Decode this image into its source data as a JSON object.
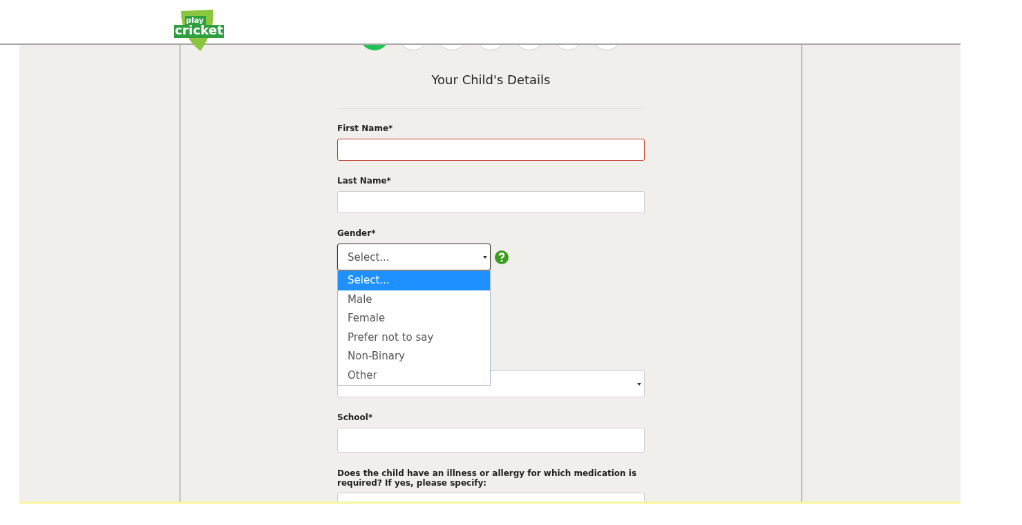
{
  "logo": {
    "top": "play",
    "bottom": "cricket"
  },
  "steps": [
    {
      "selected": true
    },
    {
      "selected": false
    },
    {
      "selected": false
    },
    {
      "selected": false
    },
    {
      "selected": false
    },
    {
      "selected": false
    },
    {
      "selected": false
    }
  ],
  "form": {
    "title": "Your Child's Details",
    "fields": [
      {
        "kind": "text",
        "label": "First Name*",
        "error": true
      },
      {
        "kind": "text",
        "label": "Last Name*",
        "error": false
      },
      {
        "kind": "select",
        "label": "Gender*",
        "value": "Select...",
        "focused": true,
        "help": true,
        "options": [
          {
            "label": "Select...",
            "selected": true
          },
          {
            "label": "Male",
            "selected": false
          },
          {
            "label": "Female",
            "selected": false
          },
          {
            "label": "Prefer not to say",
            "selected": false
          },
          {
            "label": "Non-Binary",
            "selected": false
          },
          {
            "label": "Other",
            "selected": false
          }
        ]
      },
      {
        "kind": "covered-select"
      },
      {
        "kind": "text",
        "label": "School*",
        "error": false
      },
      {
        "kind": "text",
        "label": "Does the child have an illness or allergy for which medication is required? If yes, please specify:",
        "error": false
      }
    ]
  }
}
